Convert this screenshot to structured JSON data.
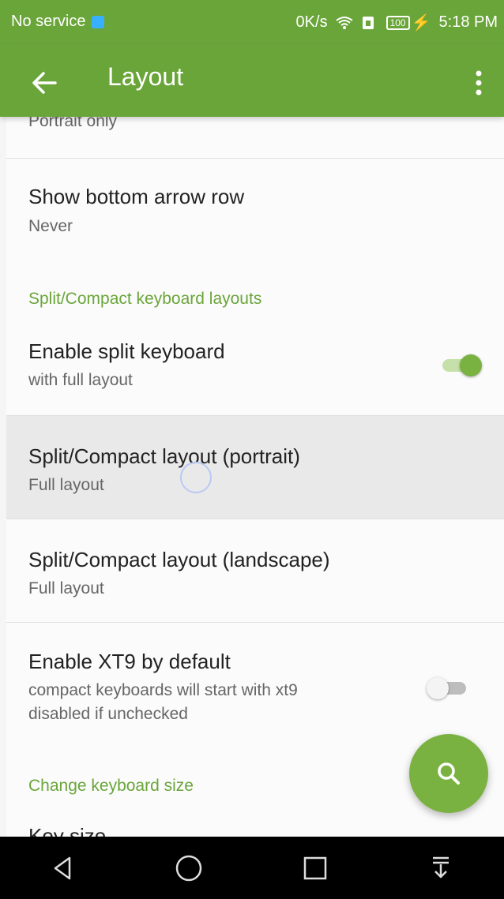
{
  "status_bar": {
    "carrier": "No service",
    "speed": "0K/s",
    "battery": "100",
    "time": "5:18 PM"
  },
  "app_bar": {
    "title": "Layout",
    "back_icon": "arrow-left-icon",
    "menu_icon": "more-vert-icon"
  },
  "settings": {
    "partial_summary": "Portrait only",
    "bottom_arrow_row": {
      "title": "Show bottom arrow row",
      "summary": "Never"
    },
    "section_split": "Split/Compact keyboard layouts",
    "enable_split": {
      "title": "Enable split keyboard",
      "summary": "with full layout",
      "checked": true
    },
    "split_portrait": {
      "title": "Split/Compact layout (portrait)",
      "summary": "Full layout"
    },
    "split_landscape": {
      "title": "Split/Compact layout (landscape)",
      "summary": "Full layout"
    },
    "enable_xt9": {
      "title": "Enable XT9 by default",
      "summary_line1": "compact keyboards will start with xt9",
      "summary_line2": "disabled if unchecked",
      "checked": false
    },
    "section_size": "Change keyboard size",
    "key_size_partial": "Key size"
  },
  "fab": {
    "icon": "search-icon"
  },
  "nav_bar": {
    "icons": [
      "back-triangle-icon",
      "home-circle-icon",
      "recents-square-icon",
      "notification-pull-icon"
    ]
  },
  "colors": {
    "accent": "#6aa53a",
    "fab": "#7ab241",
    "switch_on": "#7ab241",
    "switch_off": "#d8d8d8"
  }
}
